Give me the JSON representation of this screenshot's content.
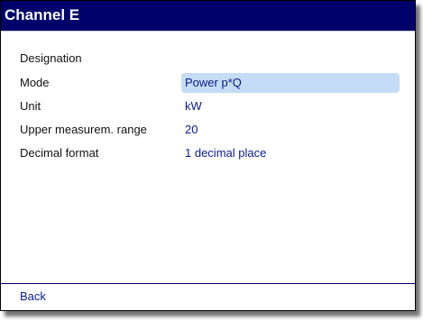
{
  "window": {
    "title": "Channel E"
  },
  "fields": {
    "designation": {
      "label": "Designation",
      "value": ""
    },
    "mode": {
      "label": "Mode",
      "value": "Power p*Q"
    },
    "unit": {
      "label": "Unit",
      "value": "kW"
    },
    "upper_range": {
      "label": "Upper measurem. range",
      "value": "20"
    },
    "decimal_format": {
      "label": "Decimal format",
      "value": "1 decimal place"
    }
  },
  "footer": {
    "back_label": "Back"
  },
  "colors": {
    "titlebar_bg": "#00006b",
    "value_text": "#0a1c8c",
    "selection_bg": "#c4dcf6"
  }
}
